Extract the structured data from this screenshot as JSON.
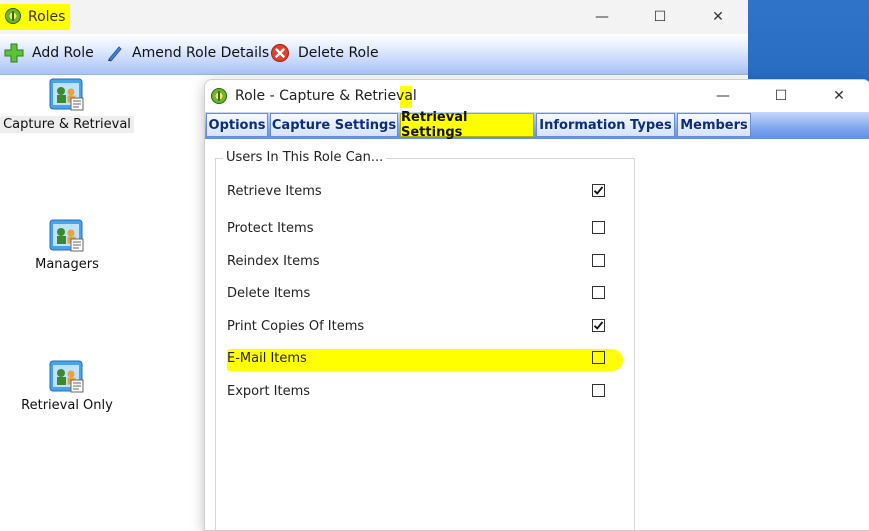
{
  "main_window": {
    "title": "Roles",
    "controls": {
      "minimize": "—",
      "maximize": "☐",
      "close": "✕"
    }
  },
  "toolbar": {
    "add_role": "Add Role",
    "amend_role": "Amend Role Details",
    "delete_role": "Delete Role"
  },
  "roles": [
    {
      "label": "Capture & Retrieval",
      "selected": true
    },
    {
      "label": "Managers",
      "selected": false
    },
    {
      "label": "Retrieval Only",
      "selected": false
    }
  ],
  "dialog": {
    "title": "Role - Capture & Retrieval",
    "controls": {
      "minimize": "—",
      "maximize": "☐",
      "close": "✕"
    },
    "tabs": [
      {
        "label": "Options",
        "active": false
      },
      {
        "label": "Capture Settings",
        "active": false
      },
      {
        "label": "Retrieval Settings",
        "active": true
      },
      {
        "label": "Information Types",
        "active": false
      },
      {
        "label": "Members",
        "active": false
      }
    ],
    "groupbox_title": "Users In This Role Can...",
    "permissions": [
      {
        "label": "Retrieve Items",
        "checked": true
      },
      {
        "label": "Protect Items",
        "checked": false
      },
      {
        "label": "Reindex Items",
        "checked": false
      },
      {
        "label": "Delete Items",
        "checked": false
      },
      {
        "label": "Print Copies Of Items",
        "checked": true
      },
      {
        "label": "E-Mail Items",
        "checked": false
      },
      {
        "label": "Export Items",
        "checked": false
      }
    ]
  },
  "colors": {
    "highlight": "#ffff00",
    "tab_active": "#ffff00",
    "toolbar_gradient_end": "#a9c3f6"
  }
}
